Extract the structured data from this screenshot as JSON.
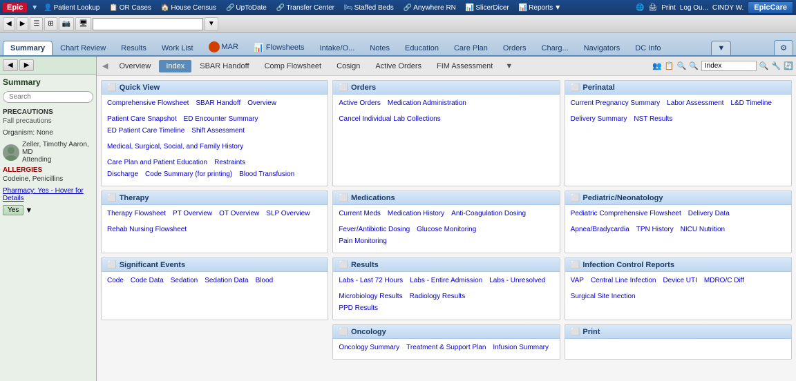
{
  "topbar": {
    "logo": "Epic",
    "nav_items": [
      {
        "icon": "👤",
        "label": "Patient Lookup"
      },
      {
        "icon": "📋",
        "label": "OR Cases"
      },
      {
        "icon": "🏠",
        "label": "House Census"
      },
      {
        "icon": "🔗",
        "label": "UpToDate"
      },
      {
        "icon": "🔗",
        "label": "Transfer Center"
      },
      {
        "icon": "🛏",
        "label": "Staffed Beds"
      },
      {
        "icon": "🔗",
        "label": "Anywhere RN"
      },
      {
        "icon": "📊",
        "label": "SlicerDicer"
      },
      {
        "icon": "📊",
        "label": "Reports"
      }
    ],
    "right": {
      "globe": "🌐",
      "printer": "🖨",
      "print_label": "Print",
      "logout_label": "Log Ou...",
      "user": "CINDY W.",
      "epiccare": "EpicCare"
    }
  },
  "tabs": [
    {
      "label": "Summary",
      "active": true
    },
    {
      "label": "Chart Review"
    },
    {
      "label": "Results"
    },
    {
      "label": "Work List"
    },
    {
      "label": "MAR",
      "special": "mar"
    },
    {
      "label": "Flowsheets",
      "special": "flowsheets"
    },
    {
      "label": "Intake/O..."
    },
    {
      "label": "Notes"
    },
    {
      "label": "Education"
    },
    {
      "label": "Care Plan"
    },
    {
      "label": "Orders"
    },
    {
      "label": "Charg..."
    },
    {
      "label": "Navigators"
    },
    {
      "label": "DC Info"
    }
  ],
  "sub_tabs": [
    {
      "label": "Overview"
    },
    {
      "label": "Index",
      "active": true
    },
    {
      "label": "SBAR Handoff"
    },
    {
      "label": "Comp Flowsheet"
    },
    {
      "label": "Cosign"
    },
    {
      "label": "Active Orders"
    },
    {
      "label": "FIM Assessment"
    }
  ],
  "sub_tab_search": "Index",
  "sidebar": {
    "summary_title": "Summary",
    "search_placeholder": "Search",
    "precautions_label": "PRECAUTIONS",
    "precautions_value": "Fall precautions",
    "organism_label": "Organism: None",
    "provider_name": "Zeller, Timothy Aaron, MD",
    "provider_role": "Attending",
    "allergies_label": "ALLERGIES",
    "allergies_value": "Codeine, Penicillins",
    "pharmacy_label": "Pharmacy: Yes - Hover for Details",
    "yes_label": "Yes"
  },
  "cards": {
    "quick_view": {
      "title": "Quick View",
      "links_row1": [
        "Comprehensive Flowsheet",
        "SBAR Handoff",
        "Overview",
        "Patient Care Snapshot",
        "ED Encounter Summary"
      ],
      "links_row2": [
        "ED Patient Care Timeline",
        "Shift Assessment",
        "Medical, Surgical, Social, and Family History",
        "Care Plan and Patient Education",
        "Restraints"
      ],
      "links_row3": [
        "Discharge",
        "Code Summary (for printing)",
        "Blood Transfusion"
      ]
    },
    "therapy": {
      "title": "Therapy",
      "links": [
        "Therapy Flowsheet",
        "PT Overview",
        "OT Overview",
        "SLP Overview",
        "Rehab Nursing Flowsheet"
      ]
    },
    "significant_events": {
      "title": "Significant Events",
      "links": [
        "Code",
        "Code Data",
        "Sedation",
        "Sedation Data",
        "Blood"
      ]
    },
    "orders": {
      "title": "Orders",
      "links": [
        "Active Orders",
        "Medication Administration",
        "Cancel Individual Lab Collections"
      ]
    },
    "medications": {
      "title": "Medications",
      "links": [
        "Current Meds",
        "Medication History",
        "Anti-Coagulation Dosing",
        "Fever/Antibiotic Dosing",
        "Glucose Monitoring"
      ],
      "links2": [
        "Pain Monitoring"
      ]
    },
    "results": {
      "title": "Results",
      "links": [
        "Labs - Last 72 Hours",
        "Labs - Entire Admission",
        "Labs - Unresolved",
        "Microbiology Results",
        "Radiology Results"
      ],
      "links2": [
        "PPD Results"
      ]
    },
    "perinatal": {
      "title": "Perinatal",
      "links": [
        "Current Pregnancy Summary",
        "Labor Assessment",
        "L&D Timeline",
        "Delivery Summary",
        "NST Results"
      ]
    },
    "pediatric": {
      "title": "Pediatric/Neonatology",
      "links": [
        "Pediatric Comprehensive Flowsheet",
        "Delivery Data",
        "Apnea/Bradycardia",
        "TPN History",
        "NICU Nutrition"
      ]
    },
    "infection_control": {
      "title": "Infection Control Reports",
      "links": [
        "VAP",
        "Central Line Infection",
        "Device UTI",
        "MDRO/C Diff",
        "Surgical Site Inection"
      ]
    },
    "oncology": {
      "title": "Oncology",
      "links": [
        "Oncology Summary",
        "Treatment & Support Plan",
        "Infusion Summary"
      ]
    },
    "print": {
      "title": "Print"
    }
  }
}
